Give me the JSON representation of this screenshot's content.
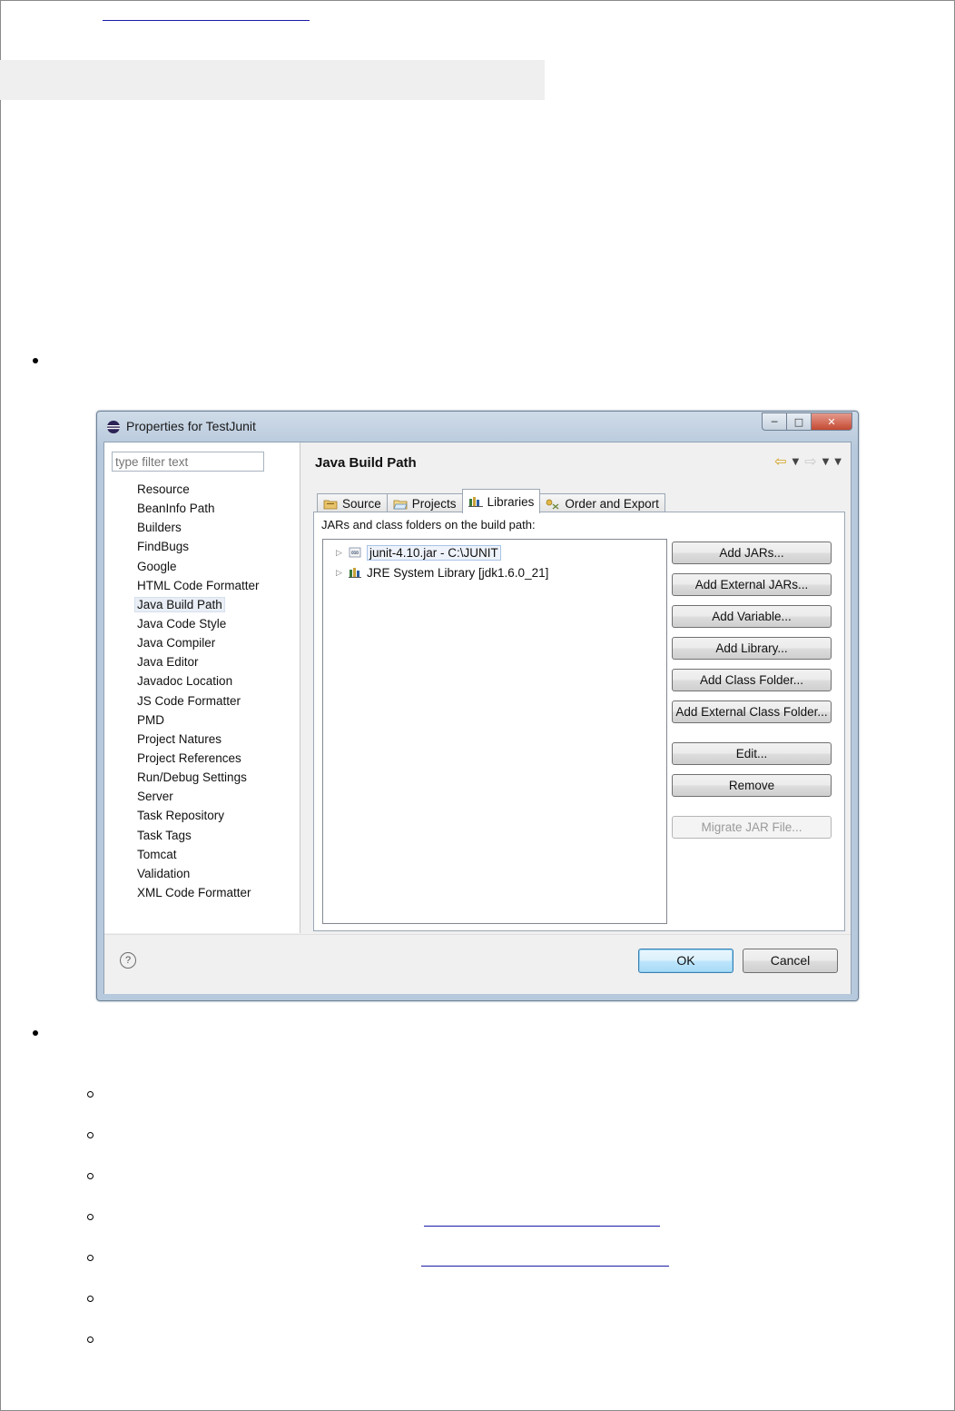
{
  "dialog": {
    "title": "Properties for TestJunit",
    "filter_placeholder": "type filter text",
    "tree_items": [
      "Resource",
      "BeanInfo Path",
      "Builders",
      "FindBugs",
      "Google",
      "HTML Code Formatter",
      "Java Build Path",
      "Java Code Style",
      "Java Compiler",
      "Java Editor",
      "Javadoc Location",
      "JS Code Formatter",
      "PMD",
      "Project Natures",
      "Project References",
      "Run/Debug Settings",
      "Server",
      "Task Repository",
      "Task Tags",
      "Tomcat",
      "Validation",
      "XML Code Formatter"
    ],
    "selected_tree_item": "Java Build Path",
    "pane_title": "Java Build Path",
    "tabs": [
      {
        "label": "Source",
        "icon": "source-folder-icon"
      },
      {
        "label": "Projects",
        "icon": "projects-folder-icon"
      },
      {
        "label": "Libraries",
        "icon": "libraries-icon"
      },
      {
        "label": "Order and Export",
        "icon": "order-export-icon"
      }
    ],
    "active_tab": "Libraries",
    "jars_label": "JARs and class folders on the build path:",
    "libraries": [
      {
        "label": "junit-4.10.jar - C:\\JUNIT",
        "icon": "jar-icon"
      },
      {
        "label": "JRE System Library [jdk1.6.0_21]",
        "icon": "library-icon"
      }
    ],
    "buttons": [
      "Add JARs...",
      "Add External JARs...",
      "Add Variable...",
      "Add Library...",
      "Add Class Folder...",
      "Add External Class Folder...",
      "Edit...",
      "Remove",
      "Migrate JAR File..."
    ],
    "ok_label": "OK",
    "cancel_label": "Cancel",
    "help_label": "?"
  },
  "colors": {
    "accent_ok": "#bee6fd",
    "close_button": "#c44a33",
    "link": "#1a1aa6"
  }
}
